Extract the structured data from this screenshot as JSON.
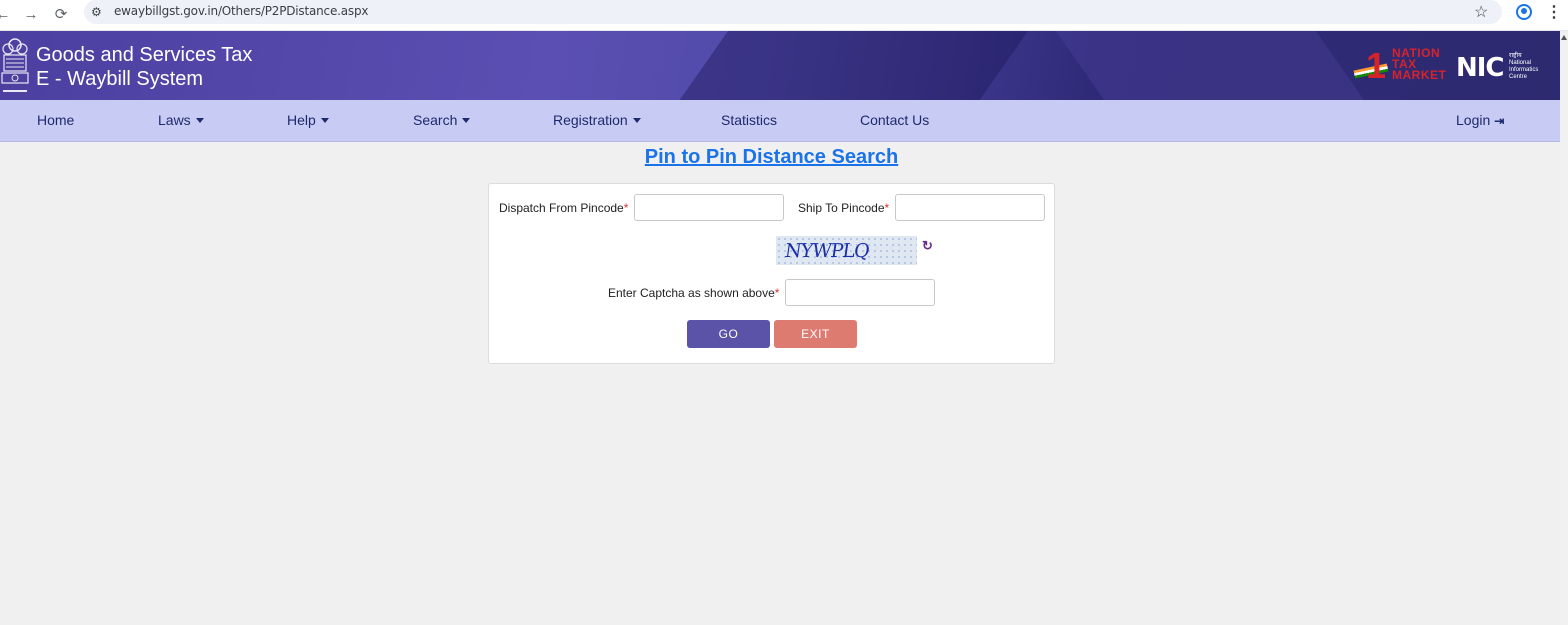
{
  "browser": {
    "url": "ewaybillgst.gov.in/Others/P2PDistance.aspx",
    "back_icon": "arrow-left-icon",
    "forward_icon": "arrow-right-icon",
    "reload_icon": "reload-icon"
  },
  "header": {
    "title_line1": "Goods and Services Tax",
    "title_line2": "E - Waybill System",
    "ntm_number": "1",
    "ntm_line1": "NATION",
    "ntm_line2": "TAX",
    "ntm_line3": "MARKET",
    "nic_logo": "NIC",
    "nic_sub1": "राष्ट्रीय",
    "nic_sub2": "National",
    "nic_sub3": "Informatics",
    "nic_sub4": "Centre"
  },
  "nav": {
    "items": [
      {
        "label": "Home"
      },
      {
        "label": "Laws"
      },
      {
        "label": "Help"
      },
      {
        "label": "Search"
      },
      {
        "label": "Registration"
      },
      {
        "label": "Statistics"
      },
      {
        "label": "Contact Us"
      }
    ],
    "login_label": "Login"
  },
  "main": {
    "title": "Pin to Pin Distance Search",
    "dispatch_label": "Dispatch From Pincode",
    "dispatch_value": "",
    "ship_label": "Ship To Pincode",
    "ship_value": "",
    "required_mark": "*",
    "captcha_text": "NYWPLQ",
    "captcha_label": "Enter Captcha as shown above",
    "captcha_value": "",
    "go_label": "GO",
    "exit_label": "EXIT"
  },
  "colors": {
    "banner": "#4b3fa0",
    "navbar": "#c8cbf3",
    "title_link": "#1a73e8",
    "go_button": "#5a53a8",
    "exit_button": "#de7b71"
  }
}
